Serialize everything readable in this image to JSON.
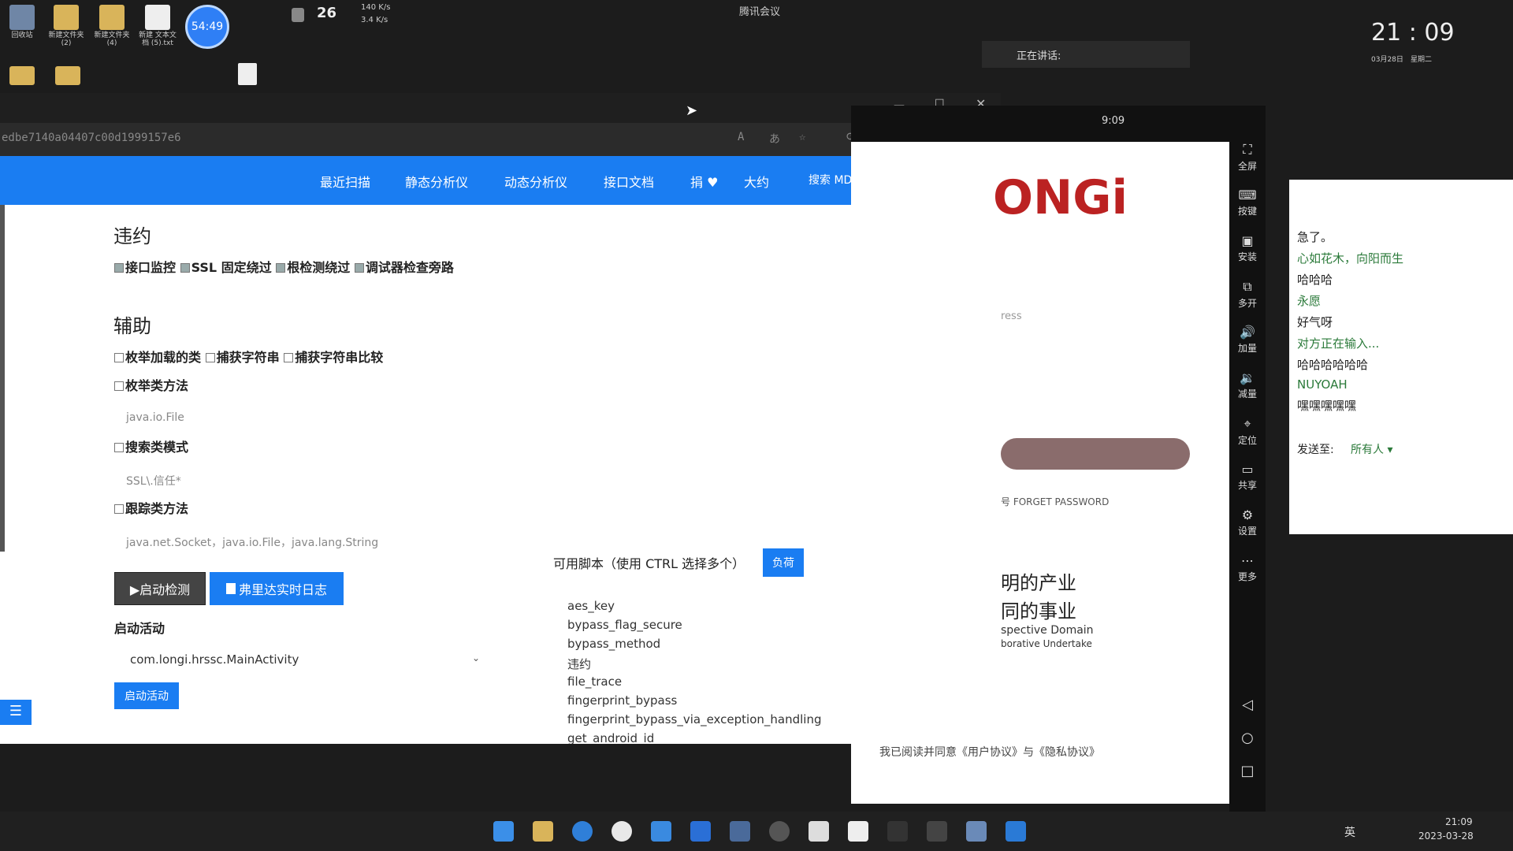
{
  "desktop": {
    "icons": [
      {
        "label": "回收站",
        "kind": "bin"
      },
      {
        "label": "新建文件夹 (2)",
        "kind": "folder"
      },
      {
        "label": "新建文件夹 (4)",
        "kind": "folder"
      },
      {
        "label": "新建 文本文档 (5).txt",
        "kind": "doc"
      }
    ],
    "meeting_timer": "54:49",
    "weather_temp": "26",
    "net_up": "140 K/s",
    "net_down": "3.4 K/s",
    "meeting_app": "腾讯会议",
    "speaking_label": "正在讲话:"
  },
  "browser": {
    "address": "edbe7140a04407c00d1999157e6",
    "nav": [
      "最近扫描",
      "静态分析仪",
      "动态分析仪",
      "接口文档",
      "捐 ♥",
      "大约",
      "搜索 MDS"
    ]
  },
  "page": {
    "section1": {
      "title": "违约",
      "checks": [
        {
          "label": "接口监控",
          "checked": true
        },
        {
          "label": "SSL 固定绕过",
          "checked": true
        },
        {
          "label": "根检测绕过",
          "checked": true
        },
        {
          "label": "调试器检查旁路",
          "checked": true
        }
      ]
    },
    "section2": {
      "title": "辅助",
      "row1": [
        {
          "label": "枚举加载的类",
          "checked": false
        },
        {
          "label": "捕获字符串",
          "checked": false
        },
        {
          "label": "捕获字符串比较",
          "checked": false
        }
      ],
      "enum_methods": {
        "label": "枚举类方法",
        "placeholder": "java.io.File"
      },
      "search_pattern": {
        "label": "搜索类模式",
        "placeholder": "SSL\\.信任*"
      },
      "trace_methods": {
        "label": "跟踪类方法",
        "placeholder": "java.net.Socket，java.io.File，java.lang.String"
      }
    },
    "start_detect_btn": "▶启动检测",
    "frida_log_btn": "弗里达实时日志",
    "activity_label": "启动活动",
    "activity_value": "com.longi.hrssc.MainActivity",
    "activity_btn": "启动活动",
    "scripts_label": "可用脚本（使用 CTRL 选择多个）",
    "scripts_btn": "负荷",
    "scripts": [
      "aes_key",
      "bypass_flag_secure",
      "bypass_method",
      "违约",
      "file_trace",
      "fingerprint_bypass",
      "fingerprint_bypass_via_exception_handling",
      "get_android_id"
    ]
  },
  "phone": {
    "time": "9:09",
    "brand": "ONGi",
    "address_hint": "ress",
    "forget": "号 FORGET PASSWORD",
    "line1": "明的产业",
    "line2": "同的事业",
    "en1": "spective Domain",
    "en2": "borative Undertake",
    "agree": "我已阅读并同意《用户协议》与《隐私协议》",
    "tools": [
      "全屏",
      "按键",
      "安装",
      "多开",
      "加量",
      "减量",
      "定位",
      "共享",
      "设置",
      "更多"
    ]
  },
  "clock": {
    "time": "21 : 09",
    "date": "03月28日",
    "weekday": "星期二"
  },
  "chat": {
    "lines": [
      {
        "text": "急了。",
        "color": "#222222"
      },
      {
        "text": "心如花木，向阳而生",
        "color": "#2b7a3a"
      },
      {
        "text": "哈哈哈",
        "color": "#222222"
      },
      {
        "text": "永愿",
        "color": "#2b7a3a"
      },
      {
        "text": "好气呀",
        "color": "#222222"
      },
      {
        "text": "对方正在输入...",
        "color": "#2b7a3a"
      },
      {
        "text": "哈哈哈哈哈哈",
        "color": "#222222"
      },
      {
        "text": "NUYOAH",
        "color": "#2b7a3a"
      },
      {
        "text": "嘿嘿嘿嘿嘿",
        "color": "#222222"
      }
    ],
    "send_to_label": "发送至:",
    "send_to_value": "所有人 ▾"
  },
  "taskbar": {
    "time": "21:09",
    "date": "2023-03-28",
    "ime": "英"
  }
}
